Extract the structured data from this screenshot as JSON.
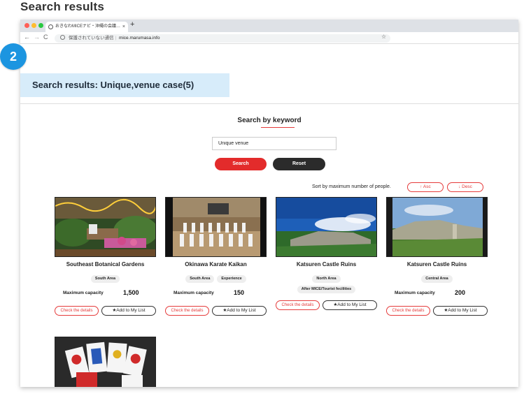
{
  "page": {
    "heading": "Search results"
  },
  "browser": {
    "tab_title": "おきなわMICEナビ・沖縄の会議…",
    "tab_close": "×",
    "new_tab": "+",
    "nav_back": "←",
    "nav_forward": "→",
    "nav_reload": "C",
    "url_security": "保護されていない通信",
    "url_host": "mice.marumasa.info",
    "bookmark_star": "☆"
  },
  "main": {
    "badge": "2",
    "result_title": "Search results: Unique,venue case(5)"
  },
  "search": {
    "title": "Search by keyword",
    "keyword_value": "Unique venue",
    "search_label": "Search",
    "reset_label": "Reset"
  },
  "sort": {
    "label": "Sort by maximum number of people.",
    "asc_label": "↑ Asc",
    "desc_label": "↓ Desc"
  },
  "cards": [
    {
      "name": "Southeast Botanical Gardens",
      "tags": [
        "South Area"
      ],
      "capacity_label": "Maximum capacity",
      "capacity": "1,500",
      "details_label": "Check the details",
      "mylist_label": "★Add to My List"
    },
    {
      "name": "Okinawa Karate Kaikan",
      "tags": [
        "South Area",
        "Experience"
      ],
      "capacity_label": "Maximum capacity",
      "capacity": "150",
      "details_label": "Check the details",
      "mylist_label": "★Add to My List"
    },
    {
      "name": "Katsuren Castle Ruins",
      "tags": [
        "North Area",
        "After MICE/Tourist fecilities"
      ],
      "details_label": "Check the details",
      "mylist_label": "★Add to My List"
    },
    {
      "name": "Katsuren Castle Ruins",
      "tags": [
        "Central Area"
      ],
      "capacity_label": "Maximum capacity",
      "capacity": "200",
      "details_label": "Check the details",
      "mylist_label": "★Add to My List"
    }
  ],
  "colors": {
    "accent_red": "#e32b2b",
    "badge_blue": "#1c95e0",
    "title_bg": "#d7ecfa"
  }
}
